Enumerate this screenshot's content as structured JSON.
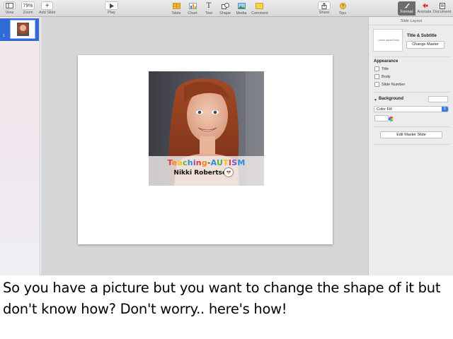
{
  "toolbar": {
    "view": "View",
    "zoom_value": "79%",
    "zoom": "Zoom",
    "add_slide": "Add Slide",
    "play": "Play",
    "table": "Table",
    "chart": "Chart",
    "text": "Text",
    "shape": "Shape",
    "media": "Media",
    "comment": "Comment",
    "share": "Share",
    "tips": "Tips",
    "format": "Format",
    "animate": "Animate",
    "document": "Document"
  },
  "navigator": {
    "slide_number": "1"
  },
  "slide": {
    "brand": "Teaching-AUTISM",
    "brand_letters": [
      "T",
      "e",
      "a",
      "c",
      "h",
      "i",
      "n",
      "g",
      "-",
      "A",
      "U",
      "T",
      "I",
      "S",
      "M"
    ],
    "brand_colors": [
      "#e23b3b",
      "#f08a1c",
      "#f2c31b",
      "#4fb648",
      "#2b8fd8",
      "#7a4fc1",
      "#e23b3b",
      "#f08a1c",
      "#555555",
      "#2b8fd8",
      "#4fb648",
      "#f2c31b",
      "#e23b3b",
      "#7a4fc1",
      "#2b8fd8"
    ],
    "name": "Nikki Robertson"
  },
  "inspector": {
    "title": "Slide Layout",
    "master_thumb_text": "Lorem Ipsum Dolor",
    "master_name": "Title & Subtitle",
    "change_master": "Change Master",
    "appearance": "Appearance",
    "options": [
      {
        "label": "Title",
        "checked": false
      },
      {
        "label": "Body",
        "checked": false
      },
      {
        "label": "Slide Number",
        "checked": false
      }
    ],
    "background": "Background",
    "fill_type": "Color Fill",
    "edit_master": "Edit Master Slide"
  },
  "caption": "So you have a picture but you want to change the shape of it but don't know how? Don't worry.. here's how!",
  "colors": {
    "selection_blue": "#2f6ad7",
    "canvas_gray": "#d5d6d8",
    "accent_blue": "#3a79e0"
  }
}
